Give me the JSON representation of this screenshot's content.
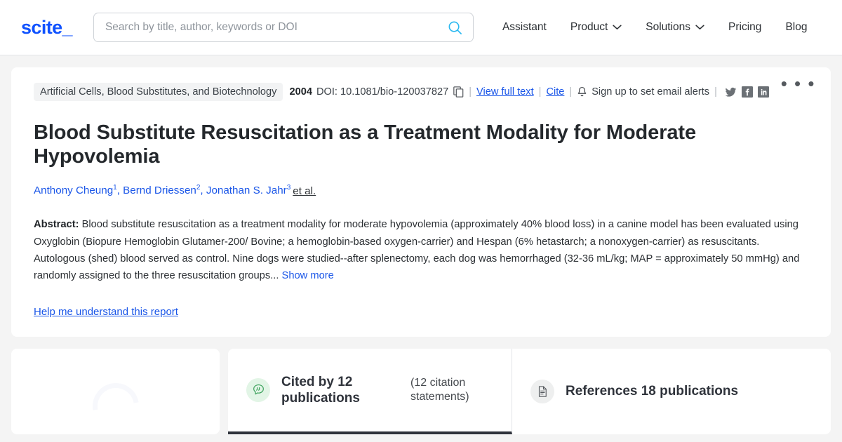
{
  "header": {
    "logo": "scite_",
    "search": {
      "placeholder": "Search by title, author, keywords or DOI",
      "value": "",
      "icon": "search-icon"
    },
    "nav": [
      {
        "label": "Assistant",
        "has_caret": false
      },
      {
        "label": "Product",
        "has_caret": true
      },
      {
        "label": "Solutions",
        "has_caret": true
      },
      {
        "label": "Pricing",
        "has_caret": false
      },
      {
        "label": "Blog",
        "has_caret": false
      }
    ]
  },
  "paper": {
    "journal": "Artificial Cells, Blood Substitutes, and Biotechnology",
    "year": "2004",
    "doi_label": "DOI: 10.1081/bio-120037827",
    "copy_icon": "copy-icon",
    "view_full_text": "View full text",
    "cite": "Cite",
    "bell_icon": "bell-icon",
    "alerts_label": "Sign up to set email alerts",
    "social": [
      {
        "name": "twitter-icon"
      },
      {
        "name": "facebook-icon"
      },
      {
        "name": "linkedin-icon"
      }
    ],
    "kebab": "• • •",
    "title": "Blood Substitute Resuscitation as a Treatment Modality for Moderate Hypovolemia",
    "authors": [
      {
        "name": "Anthony Cheung",
        "sup": "1"
      },
      {
        "name": "Bernd Driessen",
        "sup": "2"
      },
      {
        "name": "Jonathan S. Jahr",
        "sup": "3"
      }
    ],
    "et_al": "et al.",
    "abstract_label": "Abstract:",
    "abstract_text": "Blood substitute resuscitation as a treatment modality for moderate hypovolemia (approximately 40% blood loss) in a canine model has been evaluated using Oxyglobin (Biopure Hemoglobin Glutamer-200/ Bovine; a hemoglobin-based oxygen-carrier) and Hespan (6% hetastarch; a nonoxygen-carrier) as resuscitants. Autologous (shed) blood served as control. Nine dogs were studied--after splenectomy, each dog was hemorrhaged (32-36 mL/kg; MAP = approximately 50 mmHg) and randomly assigned to the three resuscitation groups...",
    "show_more": "Show more",
    "help_link": "Help me understand this report"
  },
  "bottom": {
    "spinner": {
      "name": "loading-spinner"
    },
    "tabs": [
      {
        "id": "cited-by",
        "icon": "quote-bubble-icon",
        "label": "Cited by 12 publications",
        "sub": "(12 citation statements)",
        "active": true
      },
      {
        "id": "references",
        "icon": "document-icon",
        "label": "References 18 publications",
        "sub": "",
        "active": false
      }
    ]
  },
  "colors": {
    "brand_blue": "#0F52FF",
    "link_blue": "#1a56e8",
    "search_icon": "#2ab8f0",
    "page_bg": "#f4f4f4",
    "cited_green": "#3aa05a",
    "active_tab_underline": "#2f333b"
  }
}
